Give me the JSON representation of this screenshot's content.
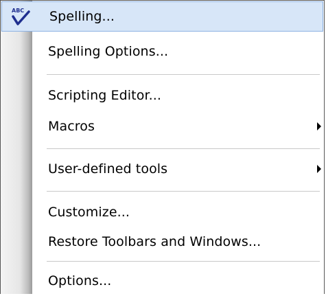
{
  "menu": {
    "items": [
      {
        "label": "Spelling...",
        "icon": "spellcheck-icon",
        "highlighted": true
      },
      {
        "label": "Spelling Options..."
      },
      {
        "label": "Scripting Editor..."
      },
      {
        "label": "Macros",
        "submenu": true
      },
      {
        "label": "User-defined tools",
        "submenu": true
      },
      {
        "label": "Customize..."
      },
      {
        "label": "Restore Toolbars and Windows..."
      },
      {
        "label": "Options..."
      }
    ],
    "icon_text": "ABC"
  },
  "colors": {
    "highlight_fill": "#d7e6f8",
    "highlight_border": "#8db2e3",
    "icon_check": "#1f2f8f"
  }
}
